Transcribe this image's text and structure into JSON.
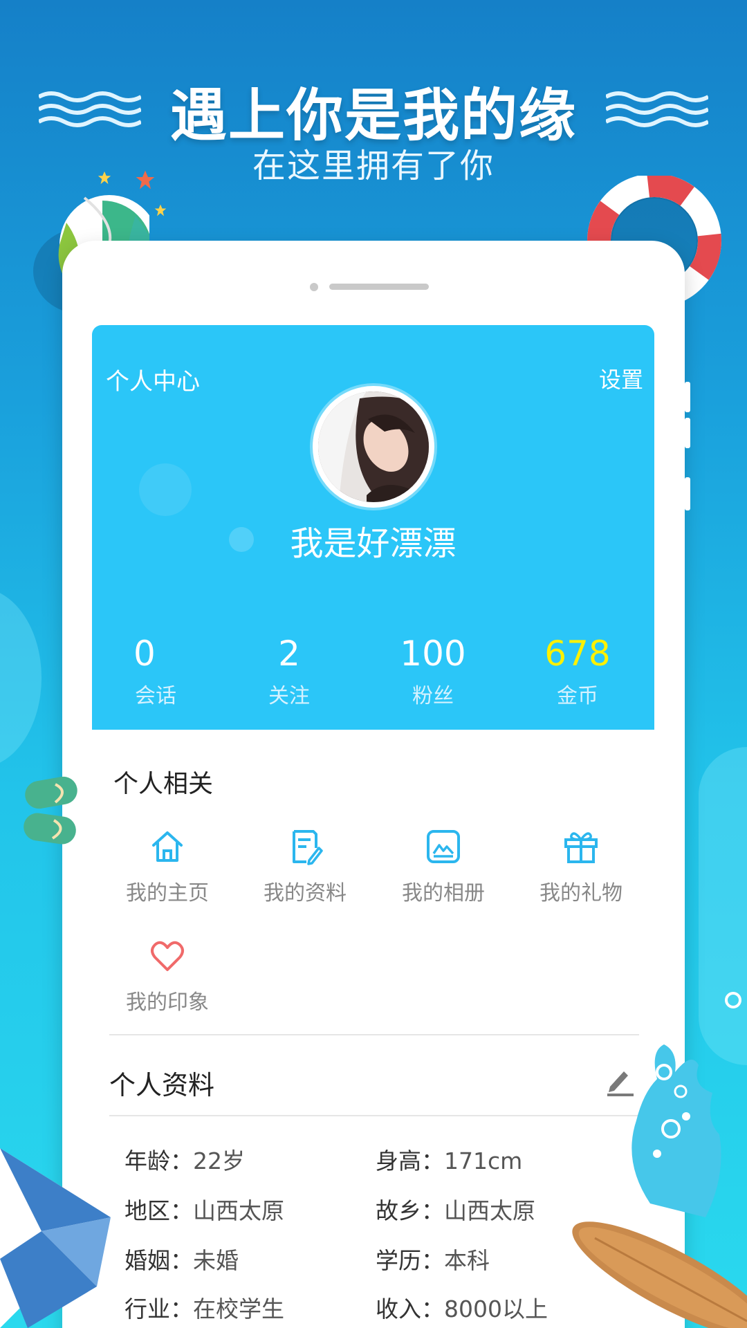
{
  "banner": {
    "headline": "遇上你是我的缘",
    "subline": "在这里拥有了你"
  },
  "profile_card": {
    "title": "个人中心",
    "settings_label": "设置",
    "username": "我是好漂漂",
    "stats": [
      {
        "value": "0",
        "label": "会话",
        "value_color": "#ffffff"
      },
      {
        "value": "2",
        "label": "关注",
        "value_color": "#ffffff"
      },
      {
        "value": "100",
        "label": "粉丝",
        "value_color": "#ffffff"
      },
      {
        "value": "678",
        "label": "金币",
        "value_color": "#fff100"
      }
    ]
  },
  "personal_related": {
    "title": "个人相关",
    "items": [
      {
        "label": "我的主页",
        "icon": "home-icon"
      },
      {
        "label": "我的资料",
        "icon": "document-edit-icon"
      },
      {
        "label": "我的相册",
        "icon": "photo-album-icon"
      },
      {
        "label": "我的礼物",
        "icon": "gift-icon"
      },
      {
        "label": "我的印象",
        "icon": "heart-icon"
      }
    ]
  },
  "personal_info": {
    "title": "个人资料",
    "edit_icon": "pencil-icon",
    "rows": [
      {
        "left_key": "年龄：",
        "left_value": "22岁",
        "right_key": "身高：",
        "right_value": "171cm"
      },
      {
        "left_key": "地区：",
        "left_value": "山西太原",
        "right_key": "故乡：",
        "right_value": "山西太原"
      },
      {
        "left_key": "婚姻：",
        "left_value": "未婚",
        "right_key": "学历：",
        "right_value": "本科"
      },
      {
        "left_key": "行业：",
        "left_value": "在校学生",
        "right_key": "收入：",
        "right_value": "8000以上"
      }
    ]
  },
  "colors": {
    "card_blue": "#2bc6f8",
    "icon_blue": "#2bb6ee",
    "heart_red": "#f06a6a",
    "coins_yellow": "#fff100"
  }
}
